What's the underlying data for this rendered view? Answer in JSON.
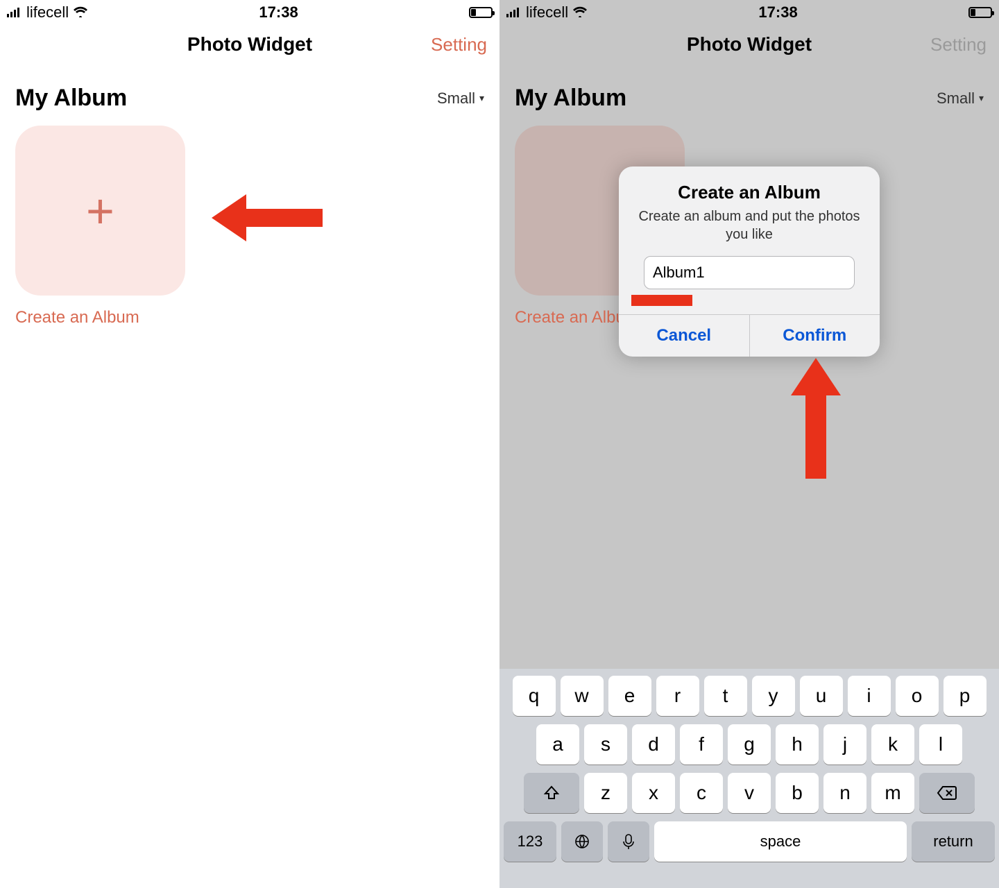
{
  "status": {
    "carrier": "lifecell",
    "time": "17:38"
  },
  "left": {
    "title": "Photo Widget",
    "setting": "Setting",
    "album_label": "My Album",
    "size": "Small",
    "tile_caption": "Create an Album"
  },
  "right": {
    "title": "Photo Widget",
    "setting": "Setting",
    "album_label": "My Album",
    "size": "Small",
    "tile_caption": "Create an Album",
    "dialog": {
      "title": "Create an Album",
      "message": "Create an album and put the photos you like",
      "input_value": "Album1",
      "cancel": "Cancel",
      "confirm": "Confirm"
    }
  },
  "keyboard": {
    "row1": [
      "q",
      "w",
      "e",
      "r",
      "t",
      "y",
      "u",
      "i",
      "o",
      "p"
    ],
    "row2": [
      "a",
      "s",
      "d",
      "f",
      "g",
      "h",
      "j",
      "k",
      "l"
    ],
    "row3": [
      "z",
      "x",
      "c",
      "v",
      "b",
      "n",
      "m"
    ],
    "num": "123",
    "space": "space",
    "return": "return"
  }
}
